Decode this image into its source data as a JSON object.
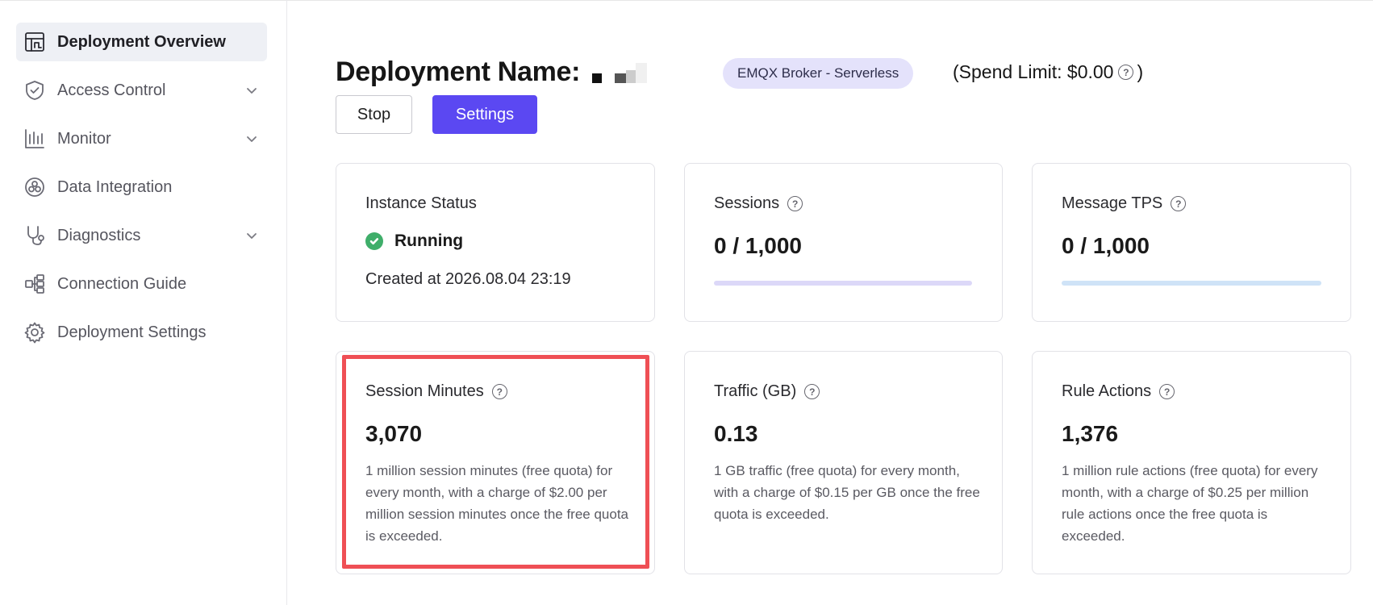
{
  "sidebar": {
    "items": [
      {
        "label": "Deployment Overview",
        "icon": "dashboard-icon",
        "active": true,
        "expandable": false
      },
      {
        "label": "Access Control",
        "icon": "shield-icon",
        "active": false,
        "expandable": true
      },
      {
        "label": "Monitor",
        "icon": "chart-icon",
        "active": false,
        "expandable": true
      },
      {
        "label": "Data Integration",
        "icon": "integration-icon",
        "active": false,
        "expandable": false
      },
      {
        "label": "Diagnostics",
        "icon": "stethoscope-icon",
        "active": false,
        "expandable": true
      },
      {
        "label": "Connection Guide",
        "icon": "connection-icon",
        "active": false,
        "expandable": false
      },
      {
        "label": "Deployment Settings",
        "icon": "gear-icon",
        "active": false,
        "expandable": false
      }
    ]
  },
  "header": {
    "title": "Deployment Name:",
    "tier_badge": "EMQX Broker - Serverless",
    "spend_limit_prefix": "(Spend Limit: $0.00",
    "spend_limit_suffix": ")",
    "help_glyph": "?"
  },
  "actions": {
    "stop_label": "Stop",
    "settings_label": "Settings"
  },
  "colors": {
    "accent": "#5b48f2",
    "running": "#3fae6a",
    "sessions_bar": "#dcd8f8",
    "tps_bar": "#cfe3f7",
    "highlight": "#ef4f55"
  },
  "cards": {
    "instance": {
      "label": "Instance Status",
      "status": "Running",
      "created": "Created at 2026.08.04 23:19"
    },
    "sessions": {
      "label": "Sessions",
      "value": "0 / 1,000",
      "usage_fraction": 0
    },
    "tps": {
      "label": "Message TPS",
      "value": "0 / 1,000",
      "usage_fraction": 0
    },
    "session_minutes": {
      "label": "Session Minutes",
      "value": "3,070",
      "desc": "1 million session minutes (free quota) for every month, with a charge of $2.00 per million session minutes once the free quota is exceeded."
    },
    "traffic": {
      "label": "Traffic (GB)",
      "value": "0.13",
      "desc": "1 GB traffic (free quota) for every month, with a charge of $0.15 per GB once the free quota is exceeded."
    },
    "rule_actions": {
      "label": "Rule Actions",
      "value": "1,376",
      "desc": "1 million rule actions (free quota) for every month, with a charge of $0.25 per million rule actions once the free quota is exceeded."
    }
  }
}
